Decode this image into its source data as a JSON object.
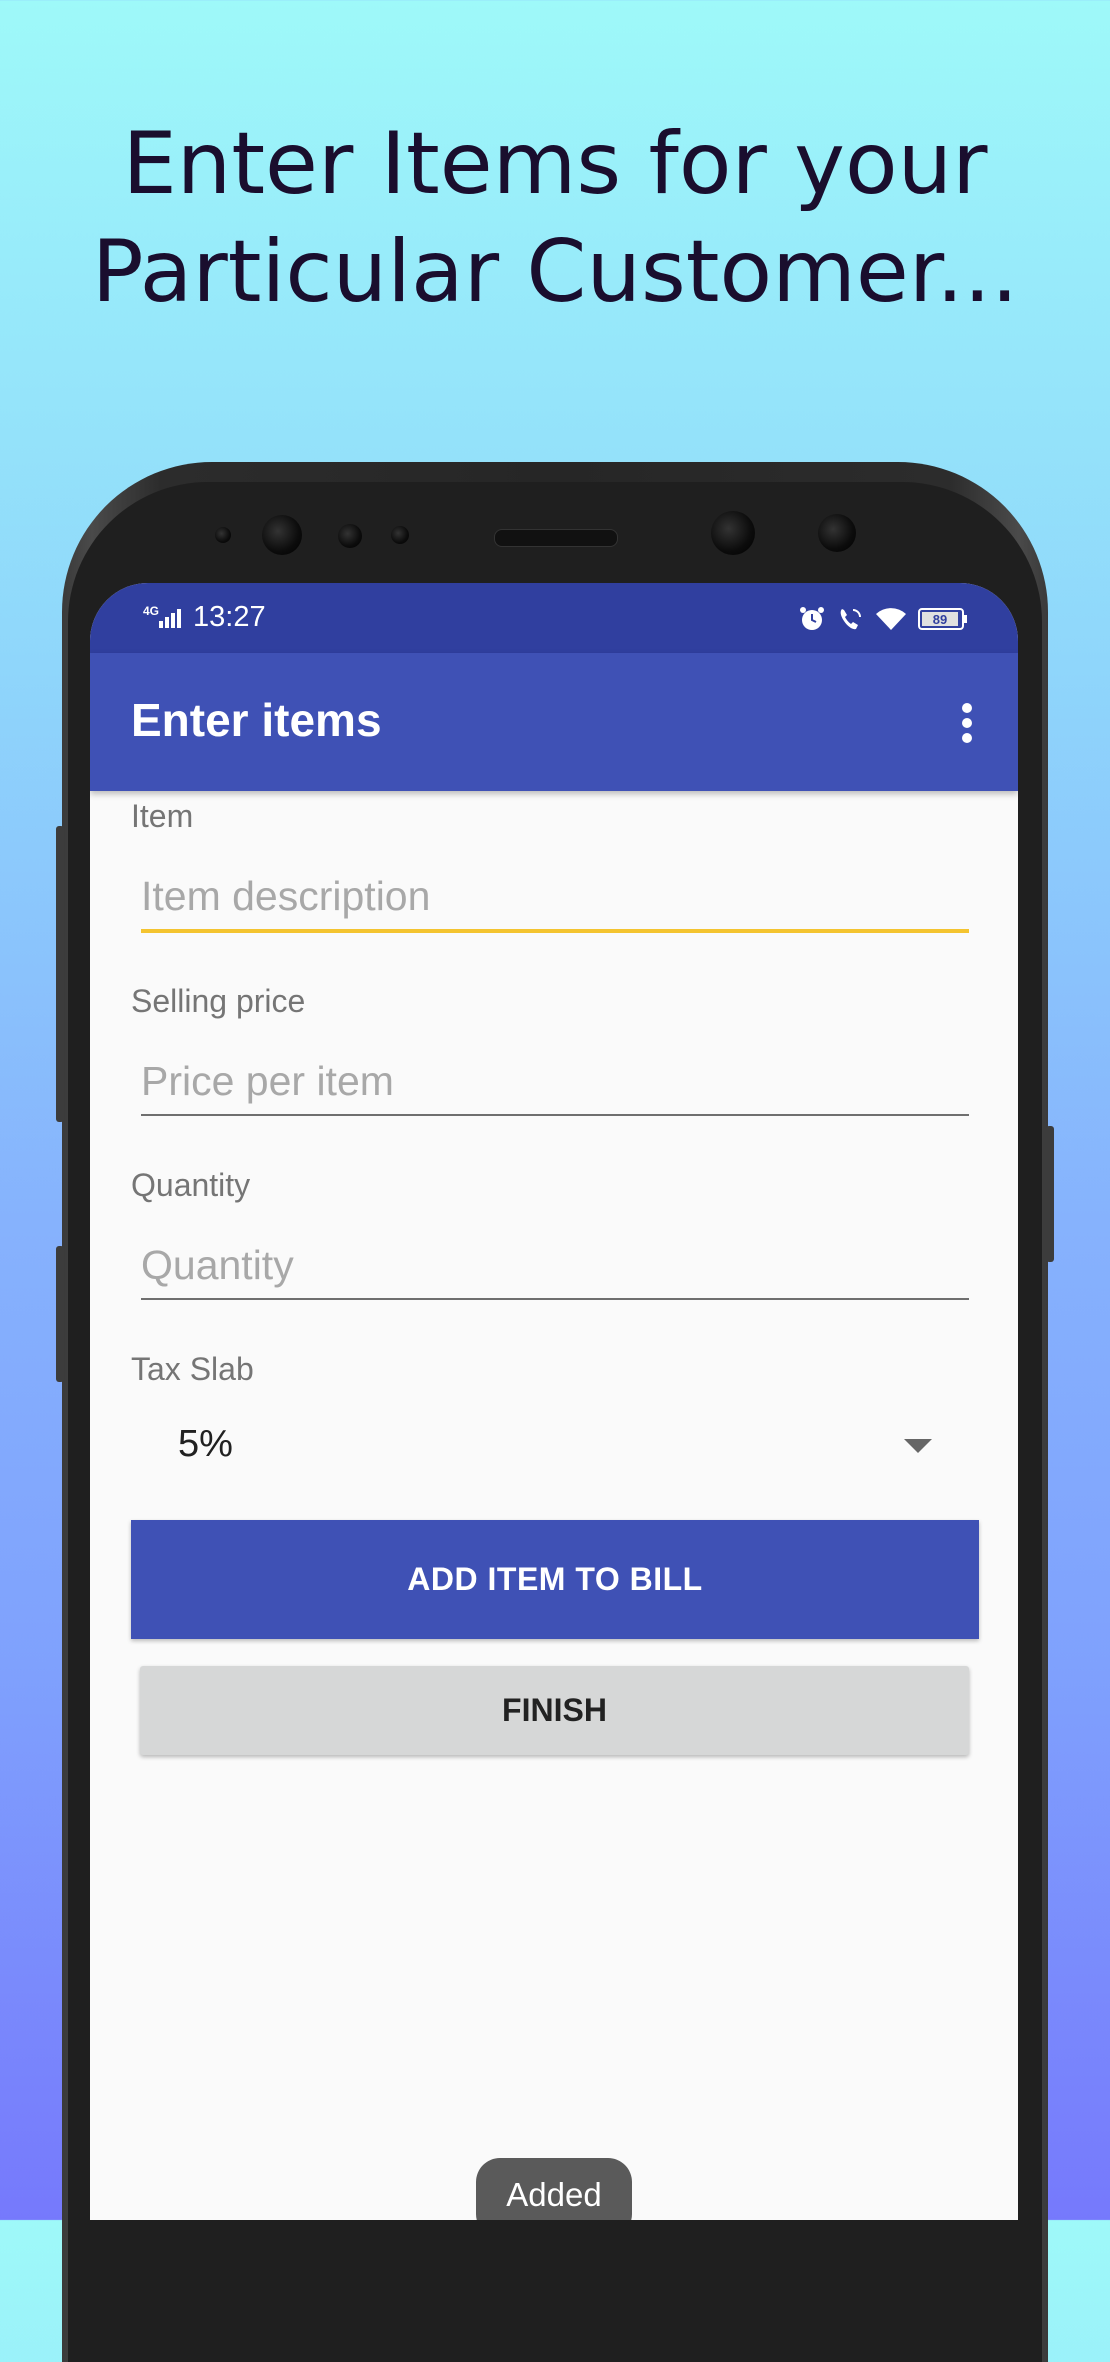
{
  "promo": {
    "headline_line1": "Enter Items for your",
    "headline_line2": "Particular Customer..."
  },
  "status_bar": {
    "network": "4G",
    "time": "13:27",
    "battery": "89",
    "icons": [
      "alarm-icon",
      "wifi-calling-icon",
      "wifi-icon",
      "battery-icon"
    ]
  },
  "app_bar": {
    "title": "Enter items",
    "menu_icon": "overflow-menu-icon"
  },
  "form": {
    "item": {
      "label": "Item",
      "placeholder": "Item description",
      "value": ""
    },
    "price": {
      "label": "Selling price",
      "placeholder": "Price per item",
      "value": ""
    },
    "quantity": {
      "label": "Quantity",
      "placeholder": "Quantity",
      "value": ""
    },
    "tax": {
      "label": "Tax Slab",
      "selected": "5%"
    }
  },
  "buttons": {
    "add": "ADD ITEM TO BILL",
    "finish": "FINISH"
  },
  "toast": "Added",
  "colors": {
    "primary": "#3f51b5",
    "primary_dark": "#303f9f",
    "accent_underline": "#f4c430"
  }
}
